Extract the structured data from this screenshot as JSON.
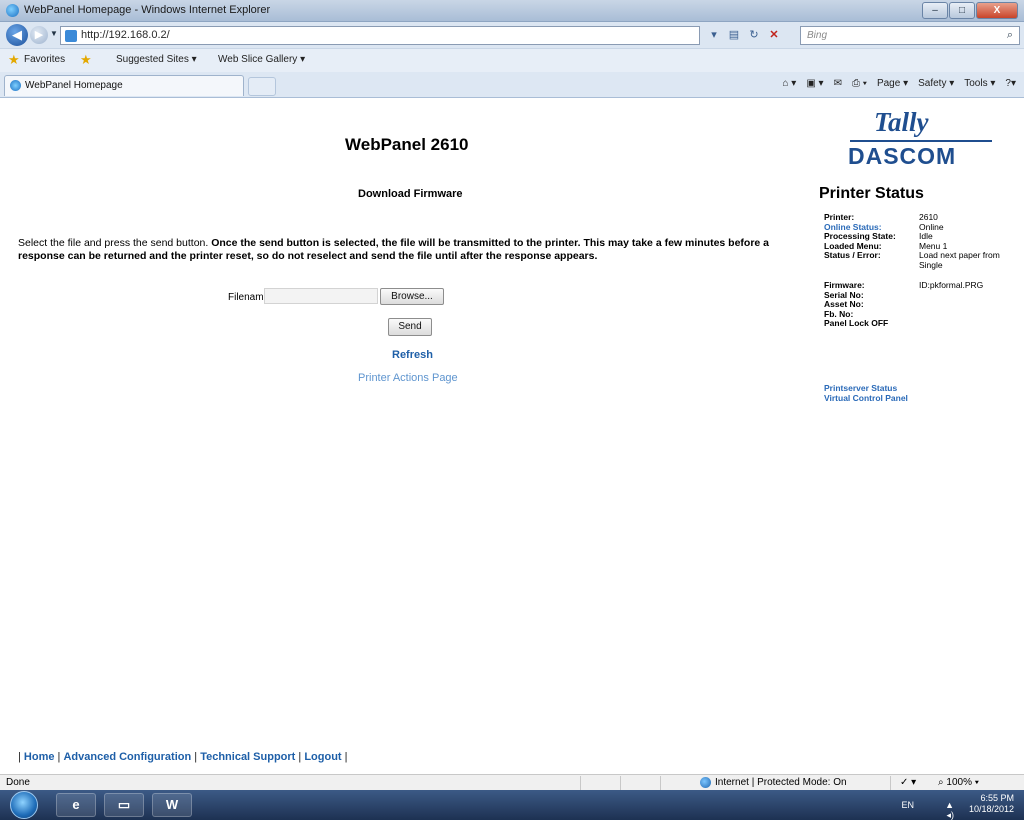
{
  "window": {
    "title": "WebPanel Homepage - Windows Internet Explorer",
    "min": "–",
    "max": "□",
    "close": "X"
  },
  "address": {
    "url": "http://192.168.0.2/",
    "search_placeholder": "Bing"
  },
  "favorites": {
    "favorites_label": "Favorites",
    "suggested_sites": "Suggested Sites ▾",
    "web_slice_gallery": "Web Slice Gallery ▾"
  },
  "tab": {
    "label": "WebPanel Homepage"
  },
  "command_bar": {
    "page": "Page ▾",
    "safety": "Safety ▾",
    "tools": "Tools ▾"
  },
  "page": {
    "heading": "WebPanel 2610",
    "subheading": "Download Firmware",
    "instructions_plain": "Select the file and press the send button.",
    "instructions_bold": "Once the send button is selected, the file will be transmitted to the printer. This may take a few minutes before a response can be returned and the printer reset, so do not reselect and send the file until after the response appears.",
    "filename_label": "Filename",
    "filename_value": "",
    "browse_label": "Browse...",
    "send_label": "Send",
    "refresh_link": "Refresh",
    "printer_actions_link": "Printer Actions Page"
  },
  "logo": {
    "top": "Tally",
    "bottom": "DASCOM"
  },
  "status": {
    "title": "Printer Status",
    "rows": [
      {
        "key": "Printer:",
        "value": "2610"
      },
      {
        "key": "Online Status:",
        "value": "Online"
      },
      {
        "key": "Processing State:",
        "value": "Idle"
      },
      {
        "key": "Loaded Menu:",
        "value": "Menu 1"
      },
      {
        "key": "Status / Error:",
        "value": "Load next paper from Single"
      },
      {
        "key": "Firmware:",
        "value": "ID:pkformal.PRG"
      },
      {
        "key": "Serial No:",
        "value": ""
      },
      {
        "key": "Asset No:",
        "value": ""
      },
      {
        "key": "Fb. No:",
        "value": ""
      },
      {
        "key": "Panel Lock OFF",
        "value": ""
      }
    ],
    "links": [
      "Printserver Status",
      "Virtual Control Panel"
    ]
  },
  "footer": {
    "links": [
      "Home",
      "Advanced Configuration",
      "Technical Support",
      "Logout"
    ]
  },
  "statusbar": {
    "left": "Done",
    "zone": "Internet | Protected Mode: On",
    "zoom": "100%"
  },
  "taskbar": {
    "lang": "EN",
    "time": "6:55 PM",
    "date": "10/18/2012"
  }
}
